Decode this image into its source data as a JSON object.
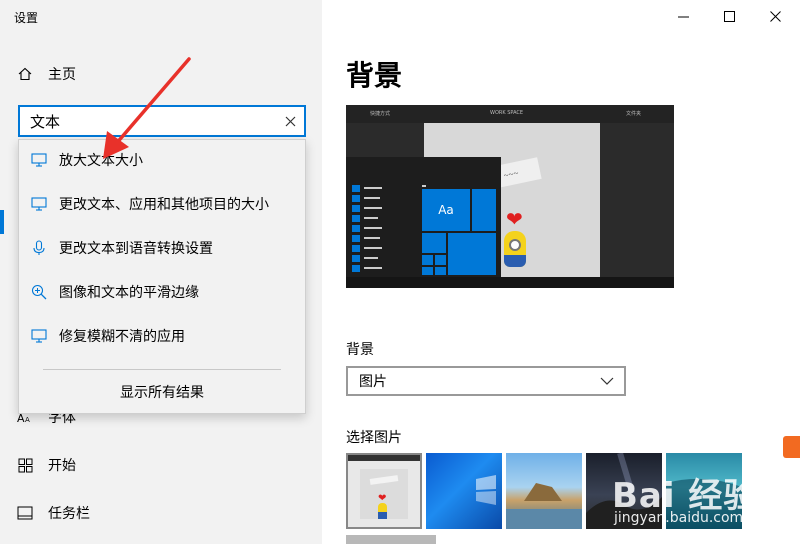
{
  "window": {
    "title": "设置",
    "minimize_icon": "minimize-icon",
    "maximize_icon": "maximize-icon",
    "close_icon": "close-icon"
  },
  "sidebar": {
    "home": {
      "label": "主页",
      "icon": "home-icon"
    },
    "items": [
      {
        "label": "字体",
        "icon": "font-icon"
      },
      {
        "label": "开始",
        "icon": "start-icon"
      },
      {
        "label": "任务栏",
        "icon": "taskbar-icon"
      }
    ]
  },
  "search": {
    "value": "文本",
    "clear_icon": "close-icon",
    "results": [
      {
        "label": "放大文本大小",
        "icon": "display-icon"
      },
      {
        "label": "更改文本、应用和其他项目的大小",
        "icon": "display-icon"
      },
      {
        "label": "更改文本到语音转换设置",
        "icon": "microphone-icon"
      },
      {
        "label": "图像和文本的平滑边缘",
        "icon": "magnifier-icon"
      },
      {
        "label": "修复模糊不清的应用",
        "icon": "display-icon"
      }
    ],
    "show_all": "显示所有结果"
  },
  "main": {
    "title": "背景",
    "preview": {
      "topbar_left": "快捷方式",
      "topbar_mid": "WORK SPACE",
      "topbar_right": "文件夹",
      "tile_text": "Aa"
    },
    "background_label": "背景",
    "background_select": "图片",
    "choose_picture_label": "选择图片"
  },
  "watermark": {
    "logo": "Bai 经验",
    "sub": "jingyan.baidu.com"
  },
  "colors": {
    "accent": "#0078d7",
    "sidebar_bg": "#f2f2f2",
    "annotation_red": "#e8312a"
  }
}
